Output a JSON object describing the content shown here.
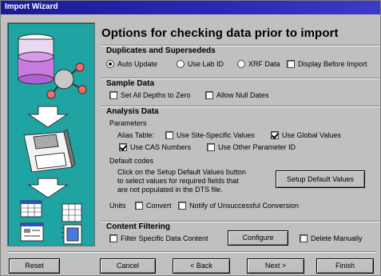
{
  "window": {
    "title": "Import Wizard"
  },
  "page": {
    "heading": "Options for checking data prior to  import"
  },
  "duplicates": {
    "title": "Duplicates and Supersededs",
    "options": [
      {
        "label": "Auto Update",
        "checked": true
      },
      {
        "label": "Use Lab ID",
        "checked": false
      },
      {
        "label": "XRF Data",
        "checked": false
      }
    ],
    "display_before_import": {
      "label": "Display Before Import",
      "checked": false
    }
  },
  "sample": {
    "title": "Sample Data",
    "set_depths_zero": {
      "label": "Set All Depths to Zero",
      "checked": false
    },
    "allow_null_dates": {
      "label": "Allow Null Dates",
      "checked": false
    }
  },
  "analysis": {
    "title": "Analysis Data",
    "parameters_label": "Parameters",
    "alias_table_label": "Alias Table:",
    "use_site_specific": {
      "label": "Use Site-Specific Values",
      "checked": false
    },
    "use_global": {
      "label": "Use Global Values",
      "checked": true
    },
    "use_cas": {
      "label": "Use CAS Numbers",
      "checked": true
    },
    "use_other_param": {
      "label": "Use Other Parameter ID",
      "checked": false
    },
    "default_codes_label": "Default codes",
    "default_codes_lines": [
      "Click on the Setup Default Values button",
      "to select values for required fields that",
      "are not populated in the DTS file."
    ],
    "setup_button": "Setup Default Values",
    "units_label": "Units",
    "convert": {
      "label": "Convert",
      "checked": false
    },
    "notify": {
      "label": "Notify of Unsuccessful Conversion",
      "checked": false
    }
  },
  "content": {
    "title": "Content Filtering",
    "filter_specific": {
      "label": "Filter Specific Data Content",
      "checked": false
    },
    "configure_button": "Configure",
    "delete_manually": {
      "label": "Delete Manually",
      "checked": false
    }
  },
  "footer": {
    "reset": "Reset",
    "cancel": "Cancel",
    "back": "< Back",
    "next": "Next >",
    "finish": "Finish"
  }
}
